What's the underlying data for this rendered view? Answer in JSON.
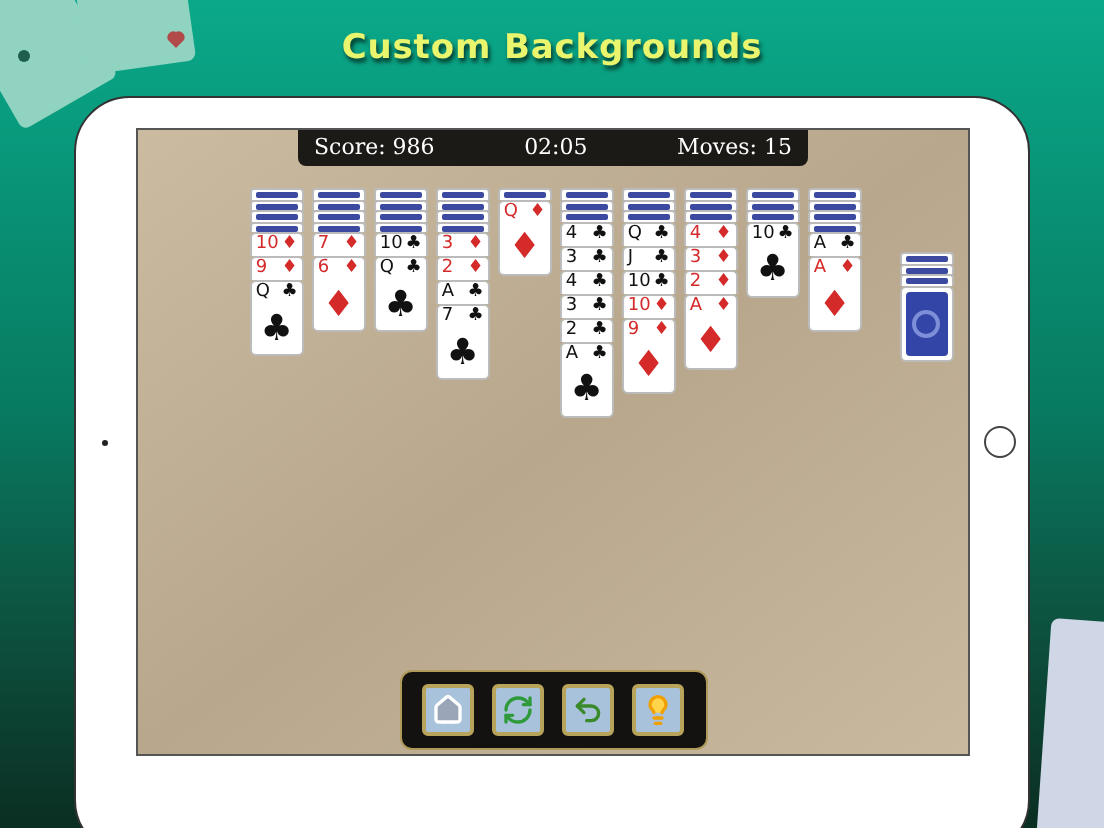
{
  "headline": "Custom Backgrounds",
  "status_bar": {
    "score": "Score: 986",
    "time": "02:05",
    "moves": "Moves: 15"
  },
  "tableau": [
    {
      "cards": [
        {
          "kind": "back"
        },
        {
          "kind": "back"
        },
        {
          "kind": "back"
        },
        {
          "kind": "back"
        },
        {
          "kind": "face",
          "rank": "10",
          "suit": "♦",
          "color": "#d42a2a"
        },
        {
          "kind": "face",
          "rank": "9",
          "suit": "♦",
          "color": "#d42a2a"
        },
        {
          "kind": "face",
          "rank": "Q",
          "suit": "♣",
          "color": "#111111",
          "pip": "♣"
        }
      ]
    },
    {
      "cards": [
        {
          "kind": "back"
        },
        {
          "kind": "back"
        },
        {
          "kind": "back"
        },
        {
          "kind": "back"
        },
        {
          "kind": "face",
          "rank": "7",
          "suit": "♦",
          "color": "#d42a2a"
        },
        {
          "kind": "face",
          "rank": "6",
          "suit": "♦",
          "color": "#d42a2a",
          "pip": "♦"
        }
      ]
    },
    {
      "cards": [
        {
          "kind": "back"
        },
        {
          "kind": "back"
        },
        {
          "kind": "back"
        },
        {
          "kind": "back"
        },
        {
          "kind": "face",
          "rank": "10",
          "suit": "♣",
          "color": "#111111"
        },
        {
          "kind": "face",
          "rank": "Q",
          "suit": "♣",
          "color": "#111111",
          "pip": "♣"
        }
      ]
    },
    {
      "cards": [
        {
          "kind": "back"
        },
        {
          "kind": "back"
        },
        {
          "kind": "back"
        },
        {
          "kind": "back"
        },
        {
          "kind": "face",
          "rank": "3",
          "suit": "♦",
          "color": "#d42a2a"
        },
        {
          "kind": "face",
          "rank": "2",
          "suit": "♦",
          "color": "#d42a2a"
        },
        {
          "kind": "face",
          "rank": "A",
          "suit": "♣",
          "color": "#111111"
        },
        {
          "kind": "face",
          "rank": "7",
          "suit": "♣",
          "color": "#111111",
          "pip": "♣"
        }
      ]
    },
    {
      "cards": [
        {
          "kind": "back"
        },
        {
          "kind": "face",
          "rank": "Q",
          "suit": "♦",
          "color": "#d42a2a",
          "pip": "♦"
        }
      ]
    },
    {
      "cards": [
        {
          "kind": "back"
        },
        {
          "kind": "back"
        },
        {
          "kind": "back"
        },
        {
          "kind": "face",
          "rank": "4",
          "suit": "♣",
          "color": "#111111"
        },
        {
          "kind": "face",
          "rank": "3",
          "suit": "♣",
          "color": "#111111"
        },
        {
          "kind": "face",
          "rank": "4",
          "suit": "♣",
          "color": "#111111"
        },
        {
          "kind": "face",
          "rank": "3",
          "suit": "♣",
          "color": "#111111"
        },
        {
          "kind": "face",
          "rank": "2",
          "suit": "♣",
          "color": "#111111"
        },
        {
          "kind": "face",
          "rank": "A",
          "suit": "♣",
          "color": "#111111",
          "pip": "♣"
        }
      ]
    },
    {
      "cards": [
        {
          "kind": "back"
        },
        {
          "kind": "back"
        },
        {
          "kind": "back"
        },
        {
          "kind": "face",
          "rank": "Q",
          "suit": "♣",
          "color": "#111111"
        },
        {
          "kind": "face",
          "rank": "J",
          "suit": "♣",
          "color": "#111111"
        },
        {
          "kind": "face",
          "rank": "10",
          "suit": "♣",
          "color": "#111111"
        },
        {
          "kind": "face",
          "rank": "10",
          "suit": "♦",
          "color": "#d42a2a"
        },
        {
          "kind": "face",
          "rank": "9",
          "suit": "♦",
          "color": "#d42a2a",
          "pip": "♦"
        }
      ]
    },
    {
      "cards": [
        {
          "kind": "back"
        },
        {
          "kind": "back"
        },
        {
          "kind": "back"
        },
        {
          "kind": "face",
          "rank": "4",
          "suit": "♦",
          "color": "#d42a2a"
        },
        {
          "kind": "face",
          "rank": "3",
          "suit": "♦",
          "color": "#d42a2a"
        },
        {
          "kind": "face",
          "rank": "2",
          "suit": "♦",
          "color": "#d42a2a"
        },
        {
          "kind": "face",
          "rank": "A",
          "suit": "♦",
          "color": "#d42a2a",
          "pip": "♦"
        }
      ]
    },
    {
      "cards": [
        {
          "kind": "back"
        },
        {
          "kind": "back"
        },
        {
          "kind": "back"
        },
        {
          "kind": "face",
          "rank": "10",
          "suit": "♣",
          "color": "#111111",
          "pip": "♣"
        }
      ]
    },
    {
      "cards": [
        {
          "kind": "back"
        },
        {
          "kind": "back"
        },
        {
          "kind": "back"
        },
        {
          "kind": "back"
        },
        {
          "kind": "face",
          "rank": "A",
          "suit": "♣",
          "color": "#111111"
        },
        {
          "kind": "face",
          "rank": "A",
          "suit": "♦",
          "color": "#d42a2a",
          "pip": "♦"
        }
      ]
    }
  ],
  "stock": {
    "cards": [
      {
        "kind": "back"
      },
      {
        "kind": "back"
      },
      {
        "kind": "back"
      },
      {
        "kind": "back"
      }
    ]
  },
  "toolbar": [
    {
      "kind": "home"
    },
    {
      "kind": "restart"
    },
    {
      "kind": "undo"
    },
    {
      "kind": "hint"
    }
  ]
}
